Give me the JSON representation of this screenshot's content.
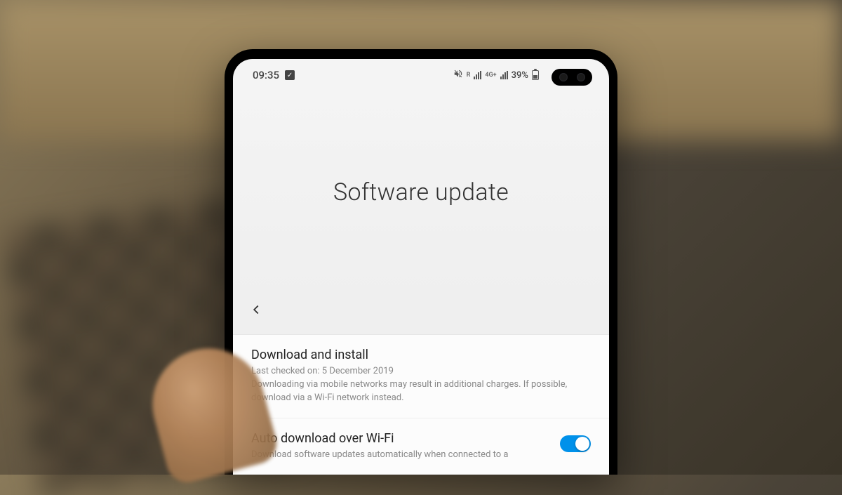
{
  "statusBar": {
    "time": "09:35",
    "networkLabel1": "R",
    "networkLabel2": "4G+",
    "batteryPercent": "39%"
  },
  "header": {
    "title": "Software update"
  },
  "items": {
    "downloadInstall": {
      "title": "Download and install",
      "lastChecked": "Last checked on: 5 December 2019",
      "description": "Downloading via mobile networks may result in additional charges. If possible, download via a Wi-Fi network instead."
    },
    "autoDownload": {
      "title": "Auto download over Wi-Fi",
      "description": "Download software updates automatically when connected to a",
      "toggleOn": true
    }
  }
}
